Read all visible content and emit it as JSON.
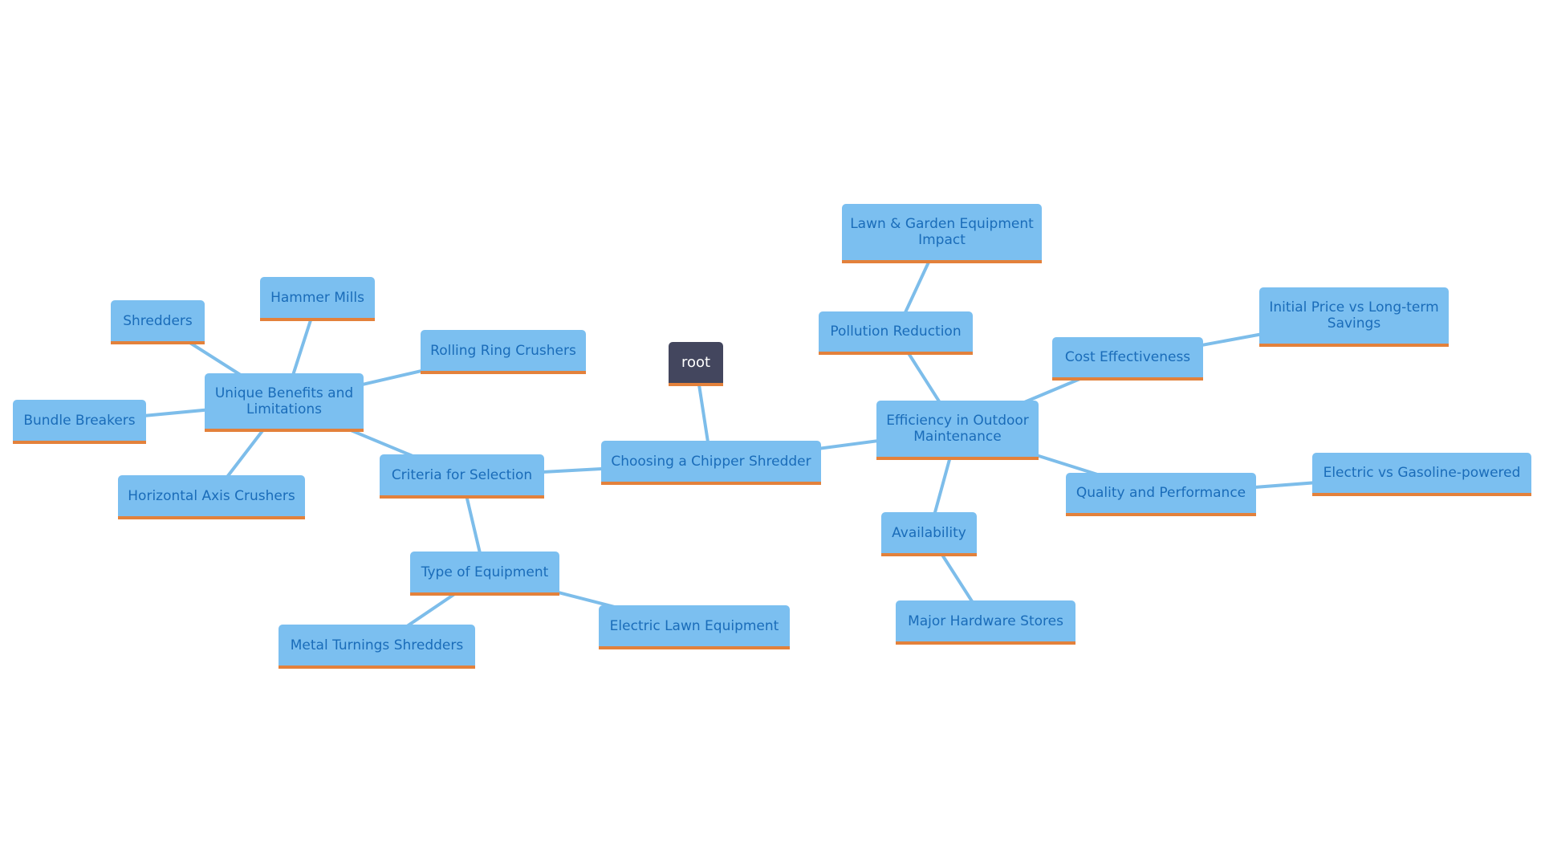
{
  "diagram": {
    "type": "mindmap",
    "colors": {
      "node_fill": "#7BBFF0",
      "node_text": "#1A6CB9",
      "node_underline": "#E3813B",
      "root_fill": "#43465E",
      "root_text": "#FFFFFF",
      "edge": "#7DBDEA"
    },
    "nodes": {
      "root": "root",
      "choosing": "Choosing a Chipper Shredder",
      "criteria": "Criteria for Selection",
      "unique": "Unique Benefits and\nLimitations",
      "shredders": "Shredders",
      "hammer": "Hammer Mills",
      "rolling": "Rolling Ring Crushers",
      "bundle": "Bundle Breakers",
      "horizontal": "Horizontal Axis Crushers",
      "type": "Type of Equipment",
      "metal": "Metal Turnings Shredders",
      "electric_lawn": "Electric Lawn Equipment",
      "efficiency": "Efficiency in Outdoor\nMaintenance",
      "pollution": "Pollution Reduction",
      "lawn_garden": "Lawn & Garden Equipment\nImpact",
      "cost": "Cost Effectiveness",
      "initial": "Initial Price vs Long-term\nSavings",
      "quality": "Quality and Performance",
      "elec_gas": "Electric vs Gasoline-powered",
      "availability": "Availability",
      "hardware": "Major Hardware Stores"
    },
    "edges": [
      [
        "root",
        "choosing"
      ],
      [
        "choosing",
        "criteria"
      ],
      [
        "choosing",
        "efficiency"
      ],
      [
        "criteria",
        "unique"
      ],
      [
        "criteria",
        "type"
      ],
      [
        "unique",
        "shredders"
      ],
      [
        "unique",
        "hammer"
      ],
      [
        "unique",
        "rolling"
      ],
      [
        "unique",
        "bundle"
      ],
      [
        "unique",
        "horizontal"
      ],
      [
        "type",
        "metal"
      ],
      [
        "type",
        "electric_lawn"
      ],
      [
        "efficiency",
        "pollution"
      ],
      [
        "pollution",
        "lawn_garden"
      ],
      [
        "efficiency",
        "cost"
      ],
      [
        "cost",
        "initial"
      ],
      [
        "efficiency",
        "quality"
      ],
      [
        "quality",
        "elec_gas"
      ],
      [
        "efficiency",
        "availability"
      ],
      [
        "availability",
        "hardware"
      ]
    ]
  }
}
